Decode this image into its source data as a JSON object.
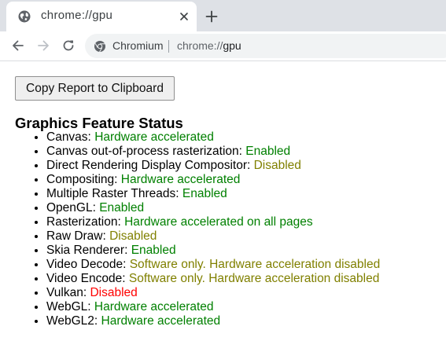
{
  "tab": {
    "title": "chrome://gpu",
    "icon": "globe-icon"
  },
  "toolbar": {
    "origin_chip": "Chromium",
    "url_scheme": "chrome://",
    "url_host": "gpu"
  },
  "page": {
    "copy_button_label": "Copy Report to Clipboard",
    "section_title": "Graphics Feature Status",
    "features": [
      {
        "name": "Canvas:",
        "status": "Hardware accelerated",
        "color": "#008000"
      },
      {
        "name": "Canvas out-of-process rasterization:",
        "status": "Enabled",
        "color": "#008000"
      },
      {
        "name": "Direct Rendering Display Compositor:",
        "status": "Disabled",
        "color": "#808000"
      },
      {
        "name": "Compositing:",
        "status": "Hardware accelerated",
        "color": "#008000"
      },
      {
        "name": "Multiple Raster Threads:",
        "status": "Enabled",
        "color": "#008000"
      },
      {
        "name": "OpenGL:",
        "status": "Enabled",
        "color": "#008000"
      },
      {
        "name": "Rasterization:",
        "status": "Hardware accelerated on all pages",
        "color": "#008000"
      },
      {
        "name": "Raw Draw:",
        "status": "Disabled",
        "color": "#808000"
      },
      {
        "name": "Skia Renderer:",
        "status": "Enabled",
        "color": "#008000"
      },
      {
        "name": "Video Decode:",
        "status": "Software only. Hardware acceleration disabled",
        "color": "#808000"
      },
      {
        "name": "Video Encode:",
        "status": "Software only. Hardware acceleration disabled",
        "color": "#808000"
      },
      {
        "name": "Vulkan:",
        "status": "Disabled",
        "color": "#ff0000"
      },
      {
        "name": "WebGL:",
        "status": "Hardware accelerated",
        "color": "#008000"
      },
      {
        "name": "WebGL2:",
        "status": "Hardware accelerated",
        "color": "#008000"
      }
    ]
  }
}
